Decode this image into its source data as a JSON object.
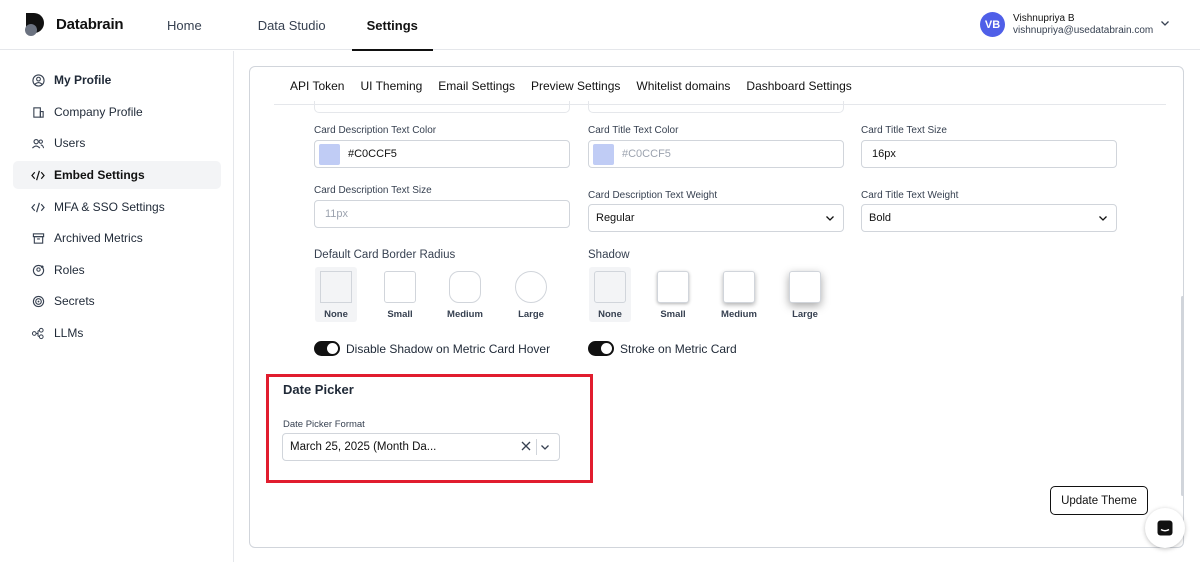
{
  "header": {
    "logo_text": "Databrain",
    "nav": [
      "Home",
      "Data Studio",
      "Settings"
    ],
    "active_nav": "Settings",
    "user": {
      "initials": "VB",
      "name": "Vishnupriya B",
      "email": "vishnupriya@usedatabrain.com"
    }
  },
  "sidebar": {
    "items": [
      {
        "label": "My Profile",
        "icon": "user-circle-icon"
      },
      {
        "label": "Company Profile",
        "icon": "building-icon"
      },
      {
        "label": "Users",
        "icon": "users-icon"
      },
      {
        "label": "Embed Settings",
        "icon": "code-icon"
      },
      {
        "label": "MFA & SSO Settings",
        "icon": "code-icon"
      },
      {
        "label": "Archived Metrics",
        "icon": "archive-icon"
      },
      {
        "label": "Roles",
        "icon": "role-icon"
      },
      {
        "label": "Secrets",
        "icon": "secret-icon"
      },
      {
        "label": "LLMs",
        "icon": "llm-icon"
      }
    ],
    "active": "Embed Settings"
  },
  "tabs": [
    "API Token",
    "UI Theming",
    "Email Settings",
    "Preview Settings",
    "Whitelist domains",
    "Dashboard Settings"
  ],
  "fields": {
    "card_desc_text_color": {
      "label": "Card Description Text Color",
      "value": "#C0CCF5"
    },
    "card_title_text_color": {
      "label": "Card Title Text Color",
      "placeholder": "#C0CCF5"
    },
    "card_title_text_size": {
      "label": "Card Title Text Size",
      "value": "16px"
    },
    "card_desc_text_size": {
      "label": "Card Description Text Size",
      "placeholder": "11px"
    },
    "card_desc_text_weight": {
      "label": "Card Description Text Weight",
      "value": "Regular"
    },
    "card_title_text_weight": {
      "label": "Card Title Text Weight",
      "value": "Bold"
    }
  },
  "border_radius": {
    "label": "Default Card Border Radius",
    "options": [
      "None",
      "Small",
      "Medium",
      "Large"
    ],
    "selected": "None"
  },
  "shadow": {
    "label": "Shadow",
    "options": [
      "None",
      "Small",
      "Medium",
      "Large"
    ],
    "selected": "None"
  },
  "toggles": {
    "disable_shadow": {
      "label": "Disable Shadow on Metric Card Hover",
      "on": true
    },
    "stroke": {
      "label": "Stroke on Metric Card",
      "on": true
    }
  },
  "date_picker": {
    "title": "Date Picker",
    "label": "Date Picker Format",
    "value": "March 25, 2025 (Month Da..."
  },
  "actions": {
    "update_theme": "Update Theme"
  },
  "colors": {
    "swatch": "#C0CCF5",
    "avatar": "#4f5fe8",
    "highlight": "#e11d2e"
  }
}
